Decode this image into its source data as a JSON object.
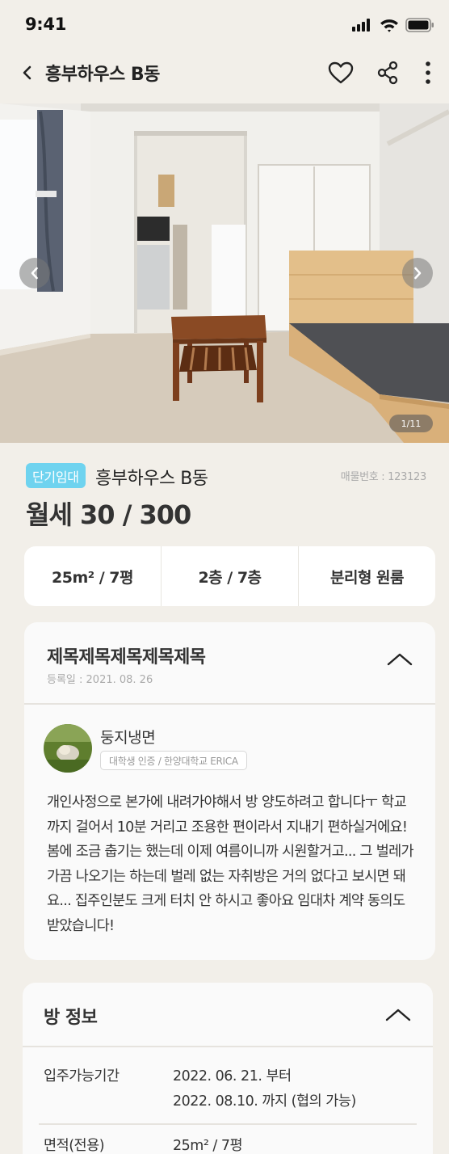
{
  "status": {
    "time": "9:41",
    "icons": [
      "signal-icon",
      "wifi-icon",
      "battery-icon"
    ]
  },
  "header": {
    "title": "흥부하우스 B동",
    "icons": [
      "back-icon",
      "heart-icon",
      "share-icon",
      "more-icon"
    ]
  },
  "gallery": {
    "counter": "1/11",
    "icons": [
      "chevron-left-icon",
      "chevron-right-icon"
    ]
  },
  "listing": {
    "tag": "단기임대",
    "title": "흥부하우스 B동",
    "listing_no": "매물번호 : 123123",
    "price": "월세 30 / 300",
    "tag_color": "#6fd3ef"
  },
  "specs": [
    "25m² / 7평",
    "2층 / 7층",
    "분리형 원룸"
  ],
  "post": {
    "title": "제목제목제목제목제목",
    "date": "등록일 : 2021. 08. 26",
    "author": "둥지냉면",
    "badge": "대학생 인증 / 한양대학교 ERICA",
    "body": "개인사정으로 본가에 내려가야해서 방 양도하려고 합니다ㅜ 학교까지 걸어서 10분 거리고 조용한 편이라서 지내기 편하실거에요! 봄에 조금 춥기는 했는데 이제 여름이니까 시원할거고... 그 벌레가 가끔 나오기는 하는데 벌레 없는 자취방은 거의 없다고 보시면 돼요... 집주인분도 크게 터치 안 하시고 좋아요 임대차 계약 동의도 받았습니다!"
  },
  "room_info": {
    "title": "방 정보",
    "rows": [
      {
        "label": "입주가능기간",
        "value_line1": "2022. 06. 21. 부터",
        "value_line2": "2022. 08.10. 까지 (협의 가능)"
      },
      {
        "label": "면적(전용)",
        "value_line1": "25m² / 7평"
      }
    ]
  },
  "colors": {
    "background": "#f2efe9",
    "card": "#ffffff",
    "accent": "#6fd3ef"
  }
}
